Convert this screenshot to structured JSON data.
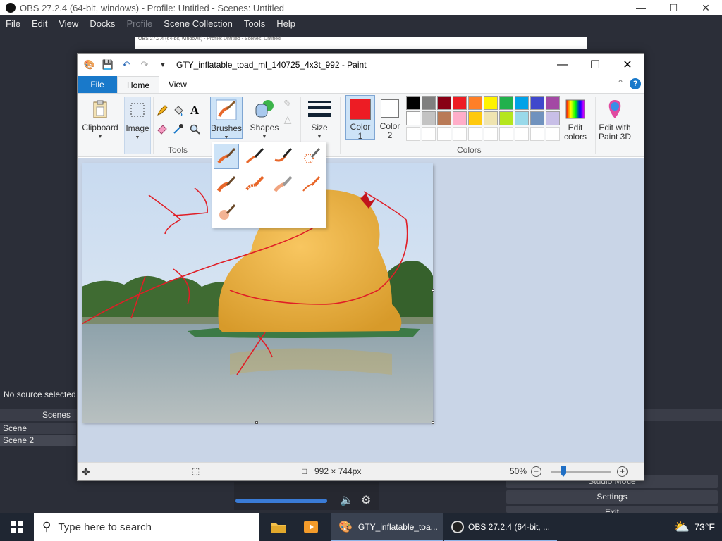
{
  "obs": {
    "title": "OBS 27.2.4 (64-bit, windows) - Profile: Untitled - Scenes: Untitled",
    "menu": [
      "File",
      "Edit",
      "View",
      "Docks",
      "Profile",
      "Scene Collection",
      "Tools",
      "Help"
    ],
    "preview_title": "OBS 27.2.4 (64-bit, windows) - Profile: Untitled - Scenes: Untitled",
    "no_source": "No source selected",
    "scenes_header": "Scenes",
    "scenes": [
      "Scene",
      "Scene 2"
    ],
    "controls": [
      "Studio Mode",
      "Settings",
      "Exit"
    ]
  },
  "paint": {
    "title": "GTY_inflatable_toad_ml_140725_4x3t_992 - Paint",
    "tabs": {
      "file": "File",
      "home": "Home",
      "view": "View"
    },
    "ribbon": {
      "clipboard": "Clipboard",
      "image": "Image",
      "tools": "Tools",
      "brushes": "Brushes",
      "shapes": "Shapes",
      "size": "Size",
      "color1_l1": "Color",
      "color1_l2": "1",
      "color2_l1": "Color",
      "color2_l2": "2",
      "edit_colors_l1": "Edit",
      "edit_colors_l2": "colors",
      "edit_paint3d_l1": "Edit with",
      "edit_paint3d_l2": "Paint 3D",
      "colors_label": "Colors"
    },
    "palette_row1": [
      "#000000",
      "#7f7f7f",
      "#880015",
      "#ed1c24",
      "#ff7f27",
      "#fff200",
      "#22b14c",
      "#00a2e8",
      "#3f48cc",
      "#a349a4"
    ],
    "palette_row2": [
      "#ffffff",
      "#c3c3c3",
      "#b97a57",
      "#ffaec9",
      "#ffc90e",
      "#efe4b0",
      "#b5e61d",
      "#99d9ea",
      "#7092be",
      "#c8bfe7"
    ],
    "color1": "#ed1c24",
    "color2": "#ffffff",
    "status": {
      "size": "992 × 744px",
      "zoom": "50%"
    }
  },
  "taskbar": {
    "search_placeholder": "Type here to search",
    "apps": [
      {
        "label": "GTY_inflatable_toa..."
      },
      {
        "label": "OBS 27.2.4 (64-bit, ..."
      }
    ],
    "temp": "73°F"
  }
}
